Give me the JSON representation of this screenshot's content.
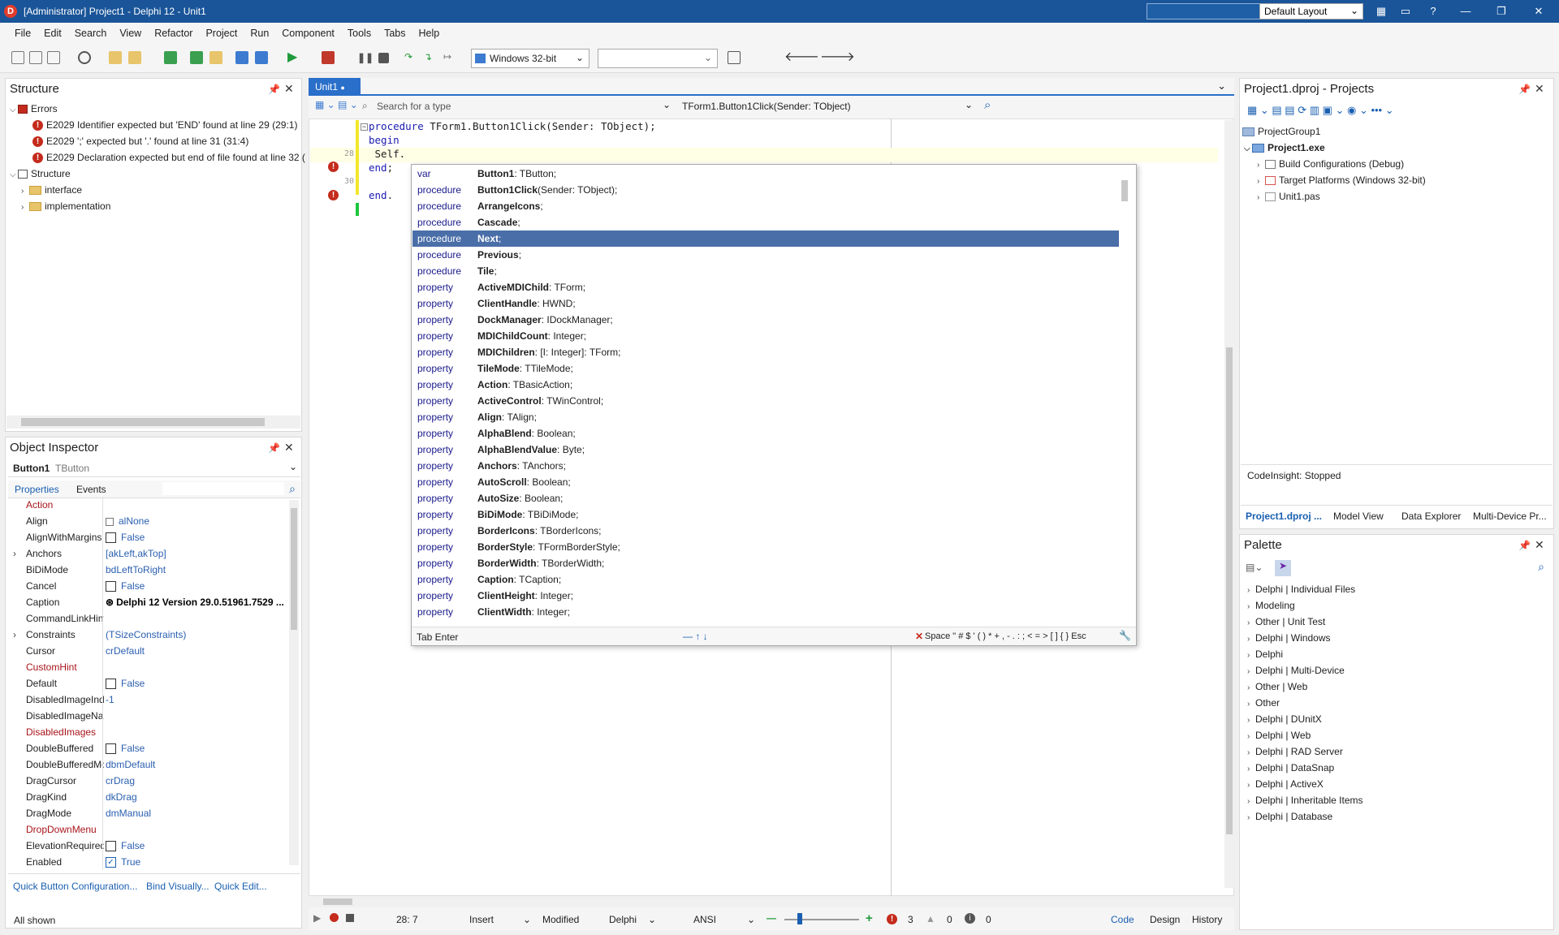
{
  "title_bar": {
    "title": "[Administrator] Project1 - Delphi 12 - Unit1",
    "layout": "Default Layout"
  },
  "menu": [
    "File",
    "Edit",
    "Search",
    "View",
    "Refactor",
    "Project",
    "Run",
    "Component",
    "Tools",
    "Tabs",
    "Help"
  ],
  "toolbar": {
    "platform": "Windows 32-bit"
  },
  "structure": {
    "title": "Structure",
    "errors_label": "Errors",
    "errors": [
      "E2029 Identifier expected but 'END' found at line 29 (29:1)",
      "E2029 ';' expected but '.' found at line 31 (31:4)",
      "E2029 Declaration expected but end of file found at line 32 ("
    ],
    "structure_label": "Structure",
    "nodes": [
      "interface",
      "implementation"
    ]
  },
  "object_inspector": {
    "title": "Object Inspector",
    "object": "Button1",
    "type": "TButton",
    "tabs": [
      "Properties",
      "Events"
    ],
    "rows": [
      {
        "name": "Action",
        "value": "",
        "red": true
      },
      {
        "name": "Align",
        "value": "alNone"
      },
      {
        "name": "AlignWithMargins",
        "value": "False",
        "check": true
      },
      {
        "name": "Anchors",
        "value": "[akLeft,akTop]",
        "expand": true
      },
      {
        "name": "BiDiMode",
        "value": "bdLeftToRight"
      },
      {
        "name": "Cancel",
        "value": "False",
        "check": true
      },
      {
        "name": "Caption",
        "value": "Delphi 12 Version 29.0.51961.7529 ...",
        "selected": true
      },
      {
        "name": "CommandLinkHint",
        "value": ""
      },
      {
        "name": "Constraints",
        "value": "(TSizeConstraints)",
        "expand": true
      },
      {
        "name": "Cursor",
        "value": "crDefault"
      },
      {
        "name": "CustomHint",
        "value": "",
        "red": true
      },
      {
        "name": "Default",
        "value": "False",
        "check": true
      },
      {
        "name": "DisabledImageIndex",
        "value": "-1"
      },
      {
        "name": "DisabledImageName",
        "value": ""
      },
      {
        "name": "DisabledImages",
        "value": "",
        "red": true
      },
      {
        "name": "DoubleBuffered",
        "value": "False",
        "check": true
      },
      {
        "name": "DoubleBufferedMode",
        "value": "dbmDefault"
      },
      {
        "name": "DragCursor",
        "value": "crDrag"
      },
      {
        "name": "DragKind",
        "value": "dkDrag"
      },
      {
        "name": "DragMode",
        "value": "dmManual"
      },
      {
        "name": "DropDownMenu",
        "value": "",
        "red": true
      },
      {
        "name": "ElevationRequired",
        "value": "False",
        "check": true
      },
      {
        "name": "Enabled",
        "value": "True",
        "check": true,
        "checked": true
      }
    ],
    "links": [
      "Quick Button Configuration...",
      "Bind Visually...",
      "Quick Edit..."
    ],
    "footer": "All shown"
  },
  "editor": {
    "tab": "Unit1",
    "search_placeholder": "Search for a type",
    "method": "TForm1.Button1Click(Sender: TObject)",
    "lines": [
      {
        "num": "",
        "kw": "procedure",
        "rest": " TForm1.Button1Click(Sender: TObject);"
      },
      {
        "num": "",
        "kw": "begin",
        "rest": ""
      },
      {
        "num": "28",
        "kw": "",
        "rest": " Self."
      },
      {
        "num": "",
        "kw": "end",
        "rest": ";"
      },
      {
        "num": "30",
        "kw": "",
        "rest": ""
      },
      {
        "num": "",
        "kw": "end",
        "rest": "."
      }
    ]
  },
  "completion": {
    "items": [
      {
        "kind": "var",
        "name": "Button1",
        "sig": ": TButton;"
      },
      {
        "kind": "procedure",
        "name": "Button1Click",
        "sig": "(Sender: TObject);"
      },
      {
        "kind": "procedure",
        "name": "ArrangeIcons",
        "sig": ";"
      },
      {
        "kind": "procedure",
        "name": "Cascade",
        "sig": ";"
      },
      {
        "kind": "procedure",
        "name": "Next",
        "sig": ";"
      },
      {
        "kind": "procedure",
        "name": "Previous",
        "sig": ";"
      },
      {
        "kind": "procedure",
        "name": "Tile",
        "sig": ";"
      },
      {
        "kind": "property",
        "name": "ActiveMDIChild",
        "sig": ": TForm;"
      },
      {
        "kind": "property",
        "name": "ClientHandle",
        "sig": ": HWND;"
      },
      {
        "kind": "property",
        "name": "DockManager",
        "sig": ": IDockManager;"
      },
      {
        "kind": "property",
        "name": "MDIChildCount",
        "sig": ": Integer;"
      },
      {
        "kind": "property",
        "name": "MDIChildren",
        "sig": ": [I: Integer]: TForm;"
      },
      {
        "kind": "property",
        "name": "TileMode",
        "sig": ": TTileMode;"
      },
      {
        "kind": "property",
        "name": "Action",
        "sig": ": TBasicAction;"
      },
      {
        "kind": "property",
        "name": "ActiveControl",
        "sig": ": TWinControl;"
      },
      {
        "kind": "property",
        "name": "Align",
        "sig": ": TAlign;"
      },
      {
        "kind": "property",
        "name": "AlphaBlend",
        "sig": ": Boolean;"
      },
      {
        "kind": "property",
        "name": "AlphaBlendValue",
        "sig": ": Byte;"
      },
      {
        "kind": "property",
        "name": "Anchors",
        "sig": ": TAnchors;"
      },
      {
        "kind": "property",
        "name": "AutoScroll",
        "sig": ": Boolean;"
      },
      {
        "kind": "property",
        "name": "AutoSize",
        "sig": ": Boolean;"
      },
      {
        "kind": "property",
        "name": "BiDiMode",
        "sig": ": TBiDiMode;"
      },
      {
        "kind": "property",
        "name": "BorderIcons",
        "sig": ": TBorderIcons;"
      },
      {
        "kind": "property",
        "name": "BorderStyle",
        "sig": ": TFormBorderStyle;"
      },
      {
        "kind": "property",
        "name": "BorderWidth",
        "sig": ": TBorderWidth;"
      },
      {
        "kind": "property",
        "name": "Caption",
        "sig": ": TCaption;"
      },
      {
        "kind": "property",
        "name": "ClientHeight",
        "sig": ": Integer;"
      },
      {
        "kind": "property",
        "name": "ClientWidth",
        "sig": ": Integer;"
      }
    ],
    "selected_index": 4,
    "footer_left": "Tab Enter",
    "footer_mid": "— ↑ ↓",
    "footer_right": "Space \" # $ ' ( ) * + , - . : ; < = > [ ] { } Esc"
  },
  "editor_status": {
    "position": "28:  7",
    "mode": "Insert",
    "modified": "Modified",
    "language": "Delphi",
    "encoding": "ANSI",
    "errors": "3",
    "warnings": "0",
    "hints": "0",
    "tabs": [
      "Code",
      "Design",
      "History"
    ]
  },
  "projects": {
    "title": "Project1.dproj - Projects",
    "group": "ProjectGroup1",
    "project": "Project1.exe",
    "children": [
      "Build Configurations (Debug)",
      "Target Platforms (Windows 32-bit)",
      "Unit1.pas"
    ],
    "status": "CodeInsight: Stopped",
    "tabs": [
      "Project1.dproj ...",
      "Model View",
      "Data Explorer",
      "Multi-Device Pr..."
    ]
  },
  "palette": {
    "title": "Palette",
    "items": [
      "Delphi | Individual Files",
      "Modeling",
      "Other | Unit Test",
      "Delphi | Windows",
      "Delphi",
      "Delphi | Multi-Device",
      "Other | Web",
      "Other",
      "Delphi | DUnitX",
      "Delphi | Web",
      "Delphi | RAD Server",
      "Delphi | DataSnap",
      "Delphi | ActiveX",
      "Delphi | Inheritable Items",
      "Delphi | Database"
    ]
  }
}
